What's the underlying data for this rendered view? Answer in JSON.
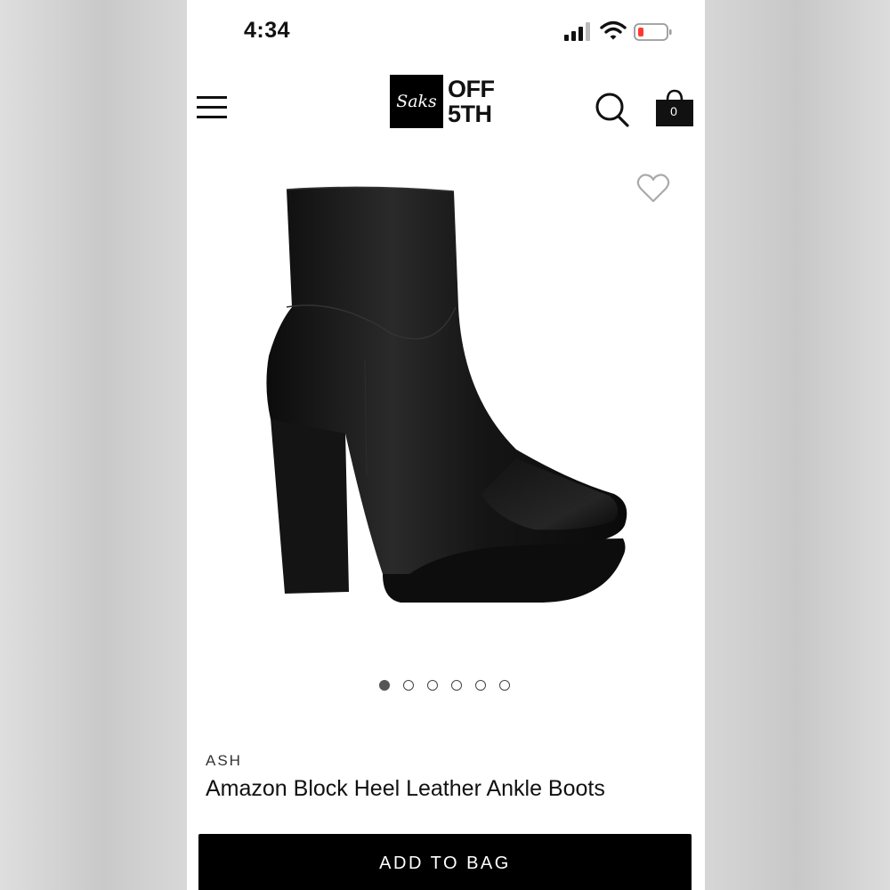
{
  "status_bar": {
    "time": "4:34",
    "icons": [
      "cellular-signal-icon",
      "wifi-icon",
      "battery-low-icon"
    ],
    "battery_color": "#ff3b30"
  },
  "header": {
    "menu_icon": "hamburger-menu-icon",
    "logo": {
      "script": "Saks",
      "line1": "OFF",
      "line2": "5TH"
    },
    "search_icon": "search-icon",
    "bag": {
      "icon": "shopping-bag-icon",
      "count": "0"
    }
  },
  "product": {
    "favorite_icon": "heart-icon",
    "image": "black-leather-platform-ankle-boot",
    "carousel": {
      "total": 6,
      "active_index": 0
    },
    "brand": "ASH",
    "name": "Amazon Block Heel Leather Ankle Boots"
  },
  "actions": {
    "add_to_bag_label": "ADD TO BAG"
  },
  "colors": {
    "primary": "#000000",
    "background": "#ffffff"
  }
}
